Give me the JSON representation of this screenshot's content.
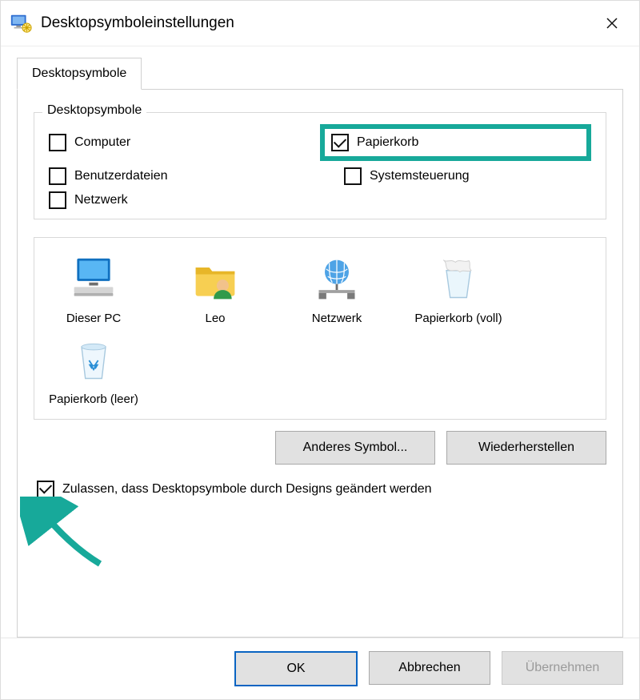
{
  "title": "Desktopsymboleinstellungen",
  "tab": {
    "label": "Desktopsymbole"
  },
  "group": {
    "title": "Desktopsymbole",
    "checks": {
      "computer": {
        "label": "Computer",
        "checked": false
      },
      "papierkorb": {
        "label": "Papierkorb",
        "checked": true
      },
      "benutzer": {
        "label": "Benutzerdateien",
        "checked": false
      },
      "system": {
        "label": "Systemsteuerung",
        "checked": false
      },
      "netzwerk": {
        "label": "Netzwerk",
        "checked": false
      }
    }
  },
  "icons": {
    "pc": {
      "label": "Dieser PC"
    },
    "user": {
      "label": "Leo"
    },
    "net": {
      "label": "Netzwerk"
    },
    "bin_full": {
      "label": "Papierkorb (voll)"
    },
    "bin_empty": {
      "label": "Papierkorb (leer)"
    }
  },
  "buttons": {
    "change": "Anderes Symbol...",
    "restore": "Wiederherstellen"
  },
  "allow": {
    "label": "Zulassen, dass Desktopsymbole durch Designs geändert werden",
    "checked": true
  },
  "footer": {
    "ok": "OK",
    "cancel": "Abbrechen",
    "apply": "Übernehmen"
  },
  "highlight": {
    "target": "papierkorb",
    "color": "#17a99a"
  }
}
